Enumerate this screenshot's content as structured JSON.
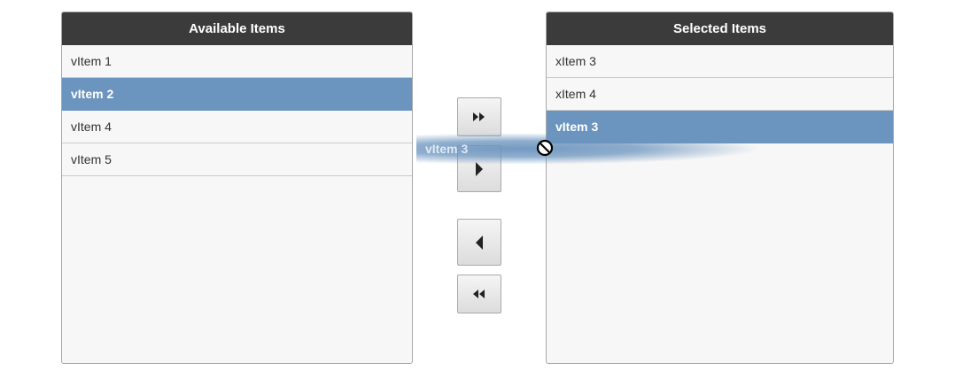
{
  "available_panel": {
    "title": "Available Items",
    "items": [
      {
        "label": "vItem 1",
        "selected": false
      },
      {
        "label": "vItem 2",
        "selected": true
      },
      {
        "label": "vItem 4",
        "selected": false
      },
      {
        "label": "vItem 5",
        "selected": false
      }
    ]
  },
  "selected_panel": {
    "title": "Selected Items",
    "items": [
      {
        "label": "xItem 3",
        "selected": false
      },
      {
        "label": "xItem 4",
        "selected": false
      },
      {
        "label": "vItem 3",
        "selected": true
      }
    ]
  },
  "transfer_buttons": [
    {
      "icon": "double-chevron-right-icon"
    },
    {
      "icon": "triangle-right-icon"
    },
    {
      "icon": "triangle-left-icon"
    },
    {
      "icon": "double-chevron-left-icon"
    }
  ],
  "drag": {
    "label": "vItem 3",
    "cursor_icon": "no-drop-icon"
  },
  "colors": {
    "header_bg": "#3b3b3b",
    "selected_bg": "#6b94be",
    "panel_bg": "#f7f7f7"
  }
}
